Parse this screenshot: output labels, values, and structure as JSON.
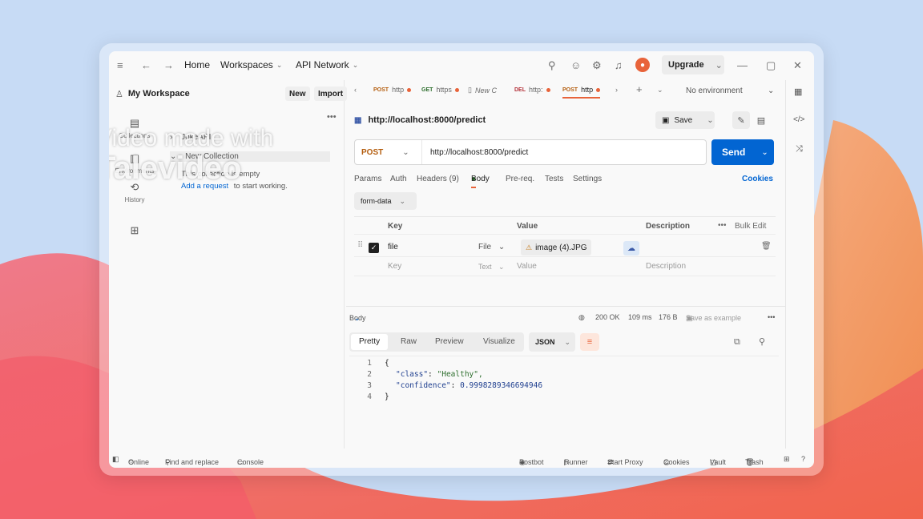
{
  "titlebar": {
    "home": "Home",
    "workspaces": "Workspaces",
    "api_network": "API Network",
    "upgrade": "Upgrade"
  },
  "sidebar": {
    "workspace_title": "My Workspace",
    "new_label": "New",
    "import_label": "Import",
    "rail": [
      "Collections",
      "Environments",
      "History"
    ],
    "collection_joke": "JokeAPI",
    "collection_new": "New Collection",
    "empty_text": "This collection is empty",
    "add_request": "Add a request",
    "add_request_suffix": "to start working."
  },
  "watermark": {
    "line1": "Video made with",
    "line2": "Talevideo"
  },
  "tabs": [
    {
      "method": "POST",
      "label": "http"
    },
    {
      "method": "GET",
      "label": "https"
    },
    {
      "method": "",
      "label": "New C"
    },
    {
      "method": "DEL",
      "label": "http:"
    },
    {
      "method": "POST",
      "label": "http"
    }
  ],
  "environment": "No environment",
  "request": {
    "name": "http://localhost:8000/predict",
    "save_label": "Save",
    "method": "POST",
    "url": "http://localhost:8000/predict",
    "send_label": "Send",
    "tabs": [
      "Params",
      "Auth",
      "Headers (9)",
      "Body",
      "Pre-req.",
      "Tests",
      "Settings"
    ],
    "cookies_label": "Cookies",
    "body_mode": "form-data"
  },
  "kv_table": {
    "headers": [
      "Key",
      "Value",
      "Description"
    ],
    "bulk_edit": "Bulk Edit",
    "row": {
      "key": "file",
      "type": "File",
      "value": "image (4).JPG"
    },
    "placeholder": {
      "key": "Key",
      "type": "Text",
      "value": "Value",
      "description": "Description"
    }
  },
  "response": {
    "body_label": "Body",
    "status": "200 OK",
    "time": "109 ms",
    "size": "176 B",
    "save_example": "Save as example",
    "view_tabs": [
      "Pretty",
      "Raw",
      "Preview",
      "Visualize"
    ],
    "format": "JSON",
    "lines": [
      {
        "n": "1",
        "text": "{"
      },
      {
        "n": "2",
        "key": "\"class\"",
        "value": "\"Healthy\","
      },
      {
        "n": "3",
        "key": "\"confidence\"",
        "value": "0.9998289346694946"
      },
      {
        "n": "4",
        "text": "}"
      }
    ]
  },
  "statusbar": {
    "online": "Online",
    "find_replace": "Find and replace",
    "console": "Console",
    "postbot": "Postbot",
    "runner": "Runner",
    "start_proxy": "Start Proxy",
    "cookies": "Cookies",
    "vault": "Vault",
    "trash": "Trash"
  },
  "colors": {
    "accent": "#e8633a",
    "send_blue": "#0265d2",
    "post_method": "#b45d0e"
  }
}
